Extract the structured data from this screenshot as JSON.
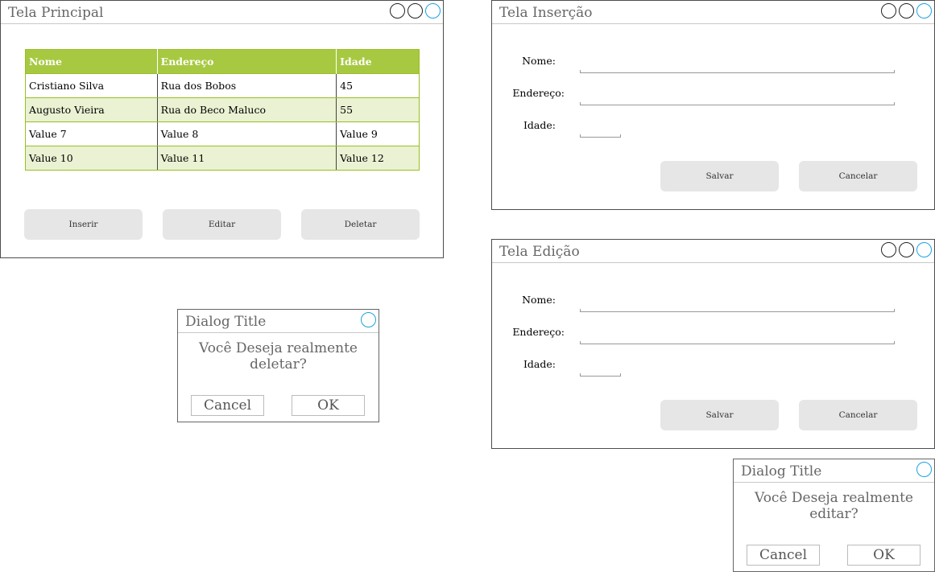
{
  "main_window": {
    "title": "Tela Principal",
    "table": {
      "headers": [
        "Nome",
        "Endereço",
        "Idade"
      ],
      "rows": [
        [
          "Cristiano Silva",
          "Rua dos Bobos",
          "45"
        ],
        [
          "Augusto Vieira",
          "Rua do Beco Maluco",
          "55"
        ],
        [
          "Value 7",
          "Value 8",
          "Value 9"
        ],
        [
          "Value 10",
          "Value 11",
          "Value 12"
        ]
      ]
    },
    "buttons": {
      "insert": "Inserir",
      "edit": "Editar",
      "delete": "Deletar"
    }
  },
  "insert_window": {
    "title": "Tela Inserção",
    "labels": {
      "name": "Nome:",
      "address": "Endereço:",
      "age": "Idade:"
    },
    "buttons": {
      "save": "Salvar",
      "cancel": "Cancelar"
    }
  },
  "edit_window": {
    "title": "Tela Edição",
    "labels": {
      "name": "Nome:",
      "address": "Endereço:",
      "age": "Idade:"
    },
    "buttons": {
      "save": "Salvar",
      "cancel": "Cancelar"
    }
  },
  "delete_dialog": {
    "title": "Dialog Title",
    "message": "Você Deseja realmente deletar?",
    "buttons": {
      "cancel": "Cancel",
      "ok": "OK"
    }
  },
  "edit_dialog": {
    "title": "Dialog Title",
    "message": "Você Deseja realmente editar?",
    "buttons": {
      "cancel": "Cancel",
      "ok": "OK"
    }
  },
  "colors": {
    "table_header": "#a7c942",
    "table_alt_row": "#eaf2d3",
    "table_border": "#98bf21",
    "button_fill": "#e6e6e6",
    "accent_circle": "#1ba1e2"
  }
}
